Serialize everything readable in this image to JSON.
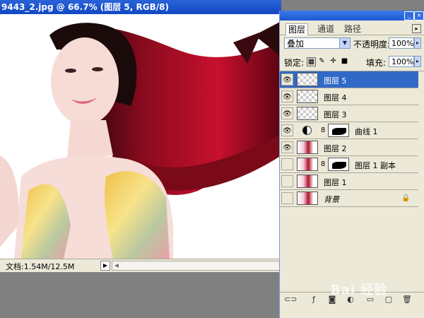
{
  "document": {
    "title": "9443_2.jpg @ 66.7% (图层 5, RGB/8)",
    "status": "文档:1.54M/12.5M"
  },
  "layers_panel": {
    "tabs": [
      "图层",
      "通道",
      "路径"
    ],
    "active_tab": "图层",
    "blend_mode": "叠加",
    "opacity_label": "不透明度:",
    "opacity_value": "100%",
    "lock_label": "锁定:",
    "fill_label": "填充:",
    "fill_value": "100%",
    "layers": [
      {
        "name": "图层 5",
        "visible": true,
        "selected": true
      },
      {
        "name": "图层 4",
        "visible": true,
        "selected": false
      },
      {
        "name": "图层 3",
        "visible": true,
        "selected": false
      },
      {
        "name": "曲线 1",
        "visible": true,
        "selected": false
      },
      {
        "name": "图层 2",
        "visible": true,
        "selected": false
      },
      {
        "name": "图层 1 副本",
        "visible": false,
        "selected": false
      },
      {
        "name": "图层 1",
        "visible": false,
        "selected": false
      },
      {
        "name": "背景",
        "visible": false,
        "selected": false,
        "locked": true
      }
    ]
  },
  "watermark": "Bai 经验"
}
